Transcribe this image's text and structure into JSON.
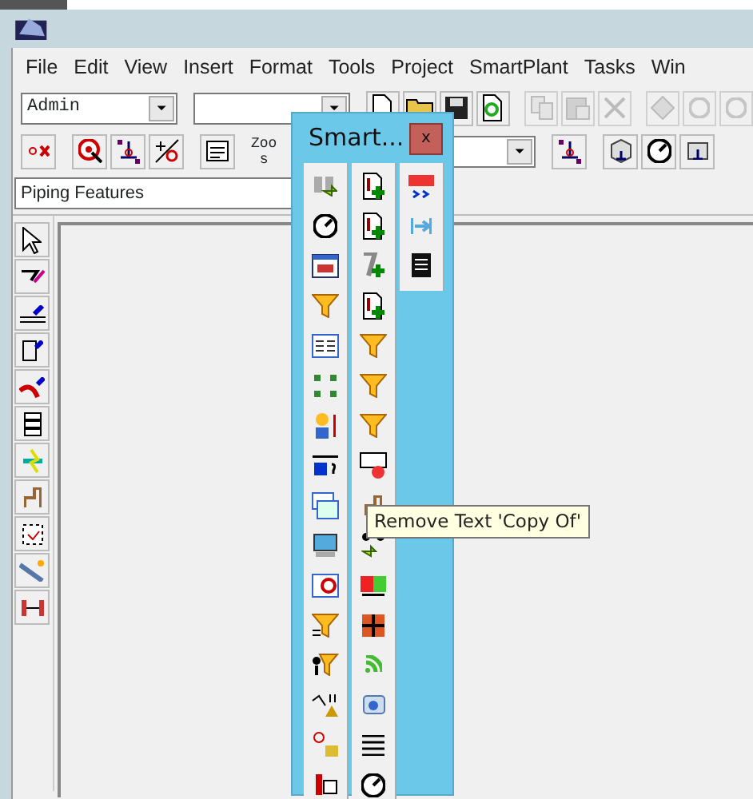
{
  "menu": [
    {
      "label": "File"
    },
    {
      "label": "Edit"
    },
    {
      "label": "View"
    },
    {
      "label": "Insert"
    },
    {
      "label": "Format"
    },
    {
      "label": "Tools"
    },
    {
      "label": "Project"
    },
    {
      "label": "SmartPlant"
    },
    {
      "label": "Tasks"
    },
    {
      "label": "Win"
    }
  ],
  "toolbar": {
    "user_combo": {
      "value": "Admin"
    },
    "zoom_label": [
      "Zoo",
      "s"
    ]
  },
  "workspace_combo": {
    "value": "Piping Features"
  },
  "palette": {
    "title": "Smart...",
    "close": "x"
  },
  "tooltip": {
    "text": "Remove Text 'Copy Of'"
  }
}
